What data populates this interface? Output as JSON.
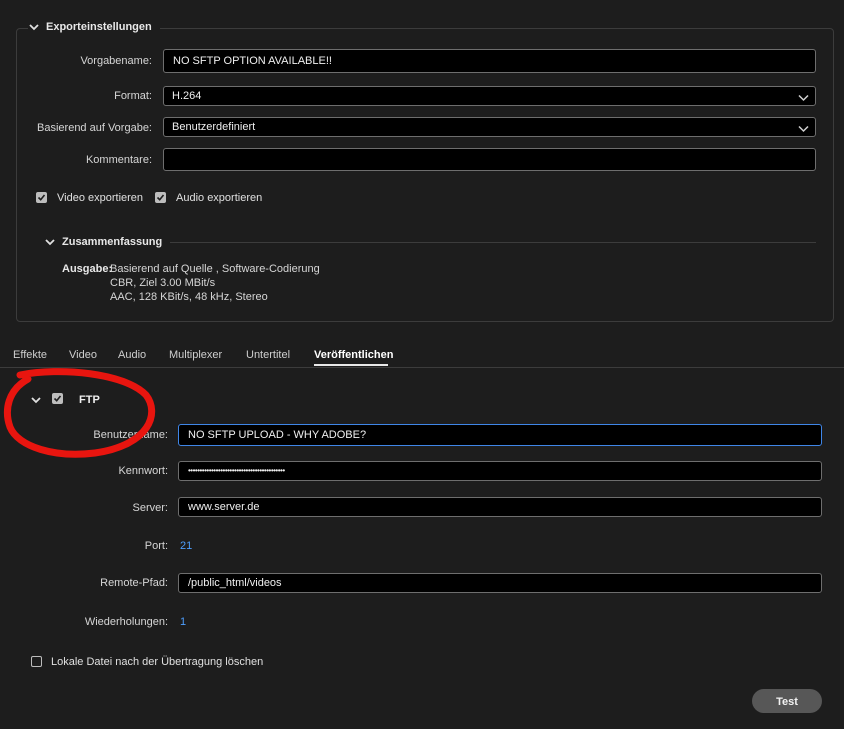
{
  "export_settings": {
    "title": "Exporteinstellungen",
    "preset_name_label": "Vorgabename:",
    "preset_name_value": "NO SFTP OPTION AVAILABLE!!",
    "format_label": "Format:",
    "format_value": "H.264",
    "based_on_label": "Basierend auf Vorgabe:",
    "based_on_value": "Benutzerdefiniert",
    "comments_label": "Kommentare:",
    "comments_value": "",
    "export_video_label": "Video exportieren",
    "export_video_checked": true,
    "export_audio_label": "Audio exportieren",
    "export_audio_checked": true
  },
  "summary": {
    "title": "Zusammenfassung",
    "output_label": "Ausgabe:",
    "line1": "Basierend auf Quelle , Software-Codierung",
    "line2": "CBR, Ziel 3.00 MBit/s",
    "line3": "AAC, 128 KBit/s, 48 kHz, Stereo"
  },
  "tabs": [
    {
      "label": "Effekte",
      "active": false
    },
    {
      "label": "Video",
      "active": false
    },
    {
      "label": "Audio",
      "active": false
    },
    {
      "label": "Multiplexer",
      "active": false
    },
    {
      "label": "Untertitel",
      "active": false
    },
    {
      "label": "Veröffentlichen",
      "active": true
    }
  ],
  "ftp": {
    "title": "FTP",
    "enabled": true,
    "username_label": "Benutzername:",
    "username_value": "NO SFTP UPLOAD - WHY ADOBE?",
    "password_label": "Kennwort:",
    "password_value": "••••••••••••••••••••••••••••••••••••••••••",
    "server_label": "Server:",
    "server_value": "www.server.de",
    "port_label": "Port:",
    "port_value": "21",
    "remote_path_label": "Remote-Pfad:",
    "remote_path_value": "/public_html/videos",
    "retries_label": "Wiederholungen:",
    "retries_value": "1",
    "delete_local_label": "Lokale Datei nach der Übertragung löschen",
    "delete_local_checked": false,
    "test_button": "Test"
  },
  "colors": {
    "background": "#1d1d1d",
    "accent_blue": "#4d9fff",
    "focus_blue": "#3f86e8",
    "annotation_red": "#e8150f"
  },
  "icons": {
    "collapse": "chevron-down-icon",
    "dropdown": "chevron-down-icon",
    "check": "checkmark-icon"
  }
}
